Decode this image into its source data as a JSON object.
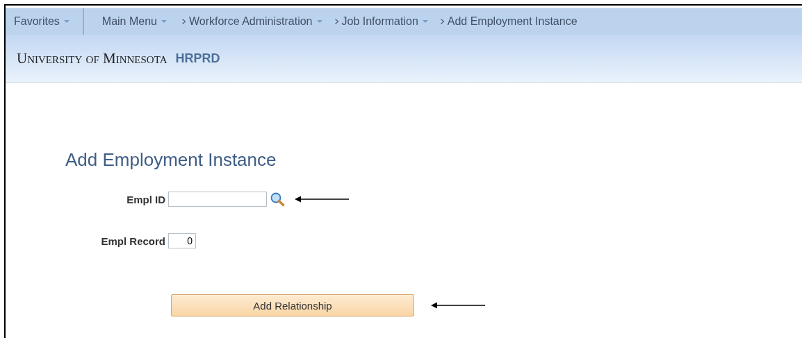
{
  "nav": {
    "favorites": "Favorites",
    "main_menu": "Main Menu",
    "breadcrumbs": [
      {
        "label": "Workforce Administration",
        "dropdown": true
      },
      {
        "label": "Job Information",
        "dropdown": true
      },
      {
        "label": "Add Employment Instance",
        "dropdown": false
      }
    ]
  },
  "header": {
    "institution": "University of Minnesota",
    "system": "HRPRD"
  },
  "page": {
    "title": "Add Employment Instance",
    "fields": [
      {
        "label": "Empl ID",
        "lookup": true,
        "pointer_arrow": true,
        "kind": "wide"
      },
      {
        "label": "Empl Record",
        "value": "0",
        "lookup": false,
        "pointer_arrow": false,
        "kind": "narrow"
      }
    ],
    "button": {
      "label": "Add Relationship",
      "pointer_arrow": true
    }
  }
}
